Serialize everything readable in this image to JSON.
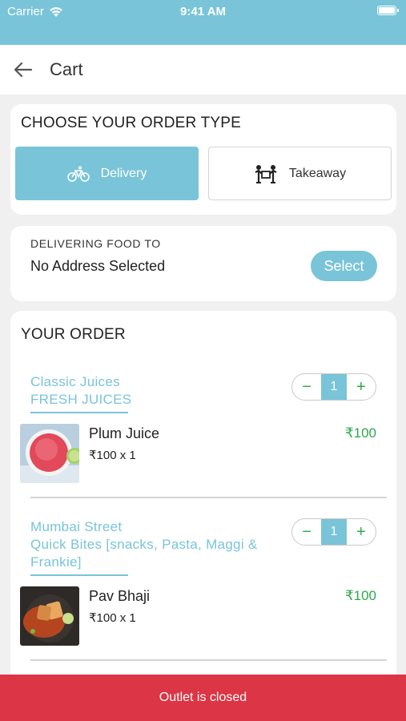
{
  "status_bar": {
    "carrier": "Carrier",
    "time": "9:41 AM"
  },
  "header": {
    "title": "Cart"
  },
  "order_type": {
    "title": "CHOOSE YOUR ORDER TYPE",
    "options": [
      {
        "label": "Delivery",
        "icon": "bicycle-icon",
        "selected": true
      },
      {
        "label": "Takeaway",
        "icon": "takeaway-icon",
        "selected": false
      }
    ]
  },
  "address": {
    "label": "DELIVERING FOOD TO",
    "value": "No Address Selected",
    "select_label": "Select"
  },
  "order": {
    "title": "YOUR ORDER",
    "outlets": [
      {
        "name_lines": [
          "Classic Juices",
          "FRESH JUICES"
        ],
        "quantity": "1",
        "item": {
          "name": "Plum Juice",
          "price_line": "₹100 x 1",
          "total": "₹100"
        }
      },
      {
        "name_lines": [
          "Mumbai Street",
          "Quick Bites [snacks, Pasta, Maggi &",
          "Frankie]"
        ],
        "quantity": "1",
        "item": {
          "name": "Pav Bhaji",
          "price_line": "₹100 x 1",
          "total": "₹100"
        }
      }
    ]
  },
  "footer": {
    "message": "Outlet is closed"
  },
  "colors": {
    "accent": "#79c4d8",
    "price": "#2ea84a",
    "alert": "#dc3545"
  }
}
